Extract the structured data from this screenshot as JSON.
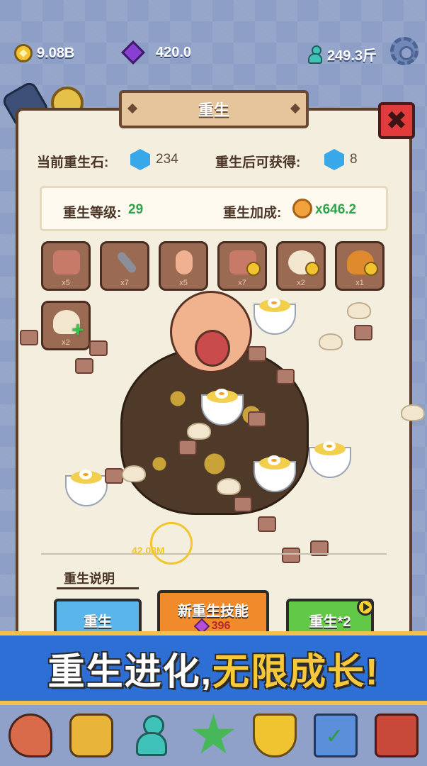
{
  "top_bar": {
    "coins": "9.08B",
    "gems": "420.0",
    "weight": "249.3斤"
  },
  "panel": {
    "title": "重生",
    "close_icon": "close-x",
    "current_stone_label": "当前重生石:",
    "current_stone_value": "234",
    "gain_label": "重生后可获得:",
    "gain_value": "8",
    "level_label": "重生等级:",
    "level_value": "29",
    "bonus_label": "重生加成:",
    "bonus_value": "x646.2"
  },
  "skills": [
    {
      "icon": "meat-cubes-icon",
      "count": "x5"
    },
    {
      "icon": "spatula-icon",
      "count": "x7"
    },
    {
      "icon": "tap-hand-icon",
      "count": "x5"
    },
    {
      "icon": "meat-cubes-coin-icon",
      "count": "x7"
    },
    {
      "icon": "bun-coin-icon",
      "count": "x2"
    },
    {
      "icon": "roast-chicken-coin-icon",
      "count": "x1"
    },
    {
      "icon": "dumpling-plus-icon",
      "count": "x2"
    }
  ],
  "progress_text": "42.03M",
  "explain_label": "重生说明",
  "buttons": {
    "rebirth": "重生",
    "new_skill": "新重生技能",
    "new_skill_cost": "396",
    "rebirth_double": "重生*2"
  },
  "banner": {
    "part1": "重生进化,",
    "part2": "无限成长!"
  },
  "nav": [
    "meat-icon",
    "fist-icon",
    "character-icon",
    "star-icon",
    "trophy-icon",
    "task-clipboard-icon",
    "shop-icon"
  ],
  "colors": {
    "panel_bg": "#f4eedf",
    "banner_bg": "#2e6fd6",
    "green_text": "#2fa24a",
    "rebirth_btn": "#5ab6ea",
    "skill_btn": "#f08a2a",
    "double_btn": "#62c848",
    "close_btn": "#e23b3b"
  }
}
